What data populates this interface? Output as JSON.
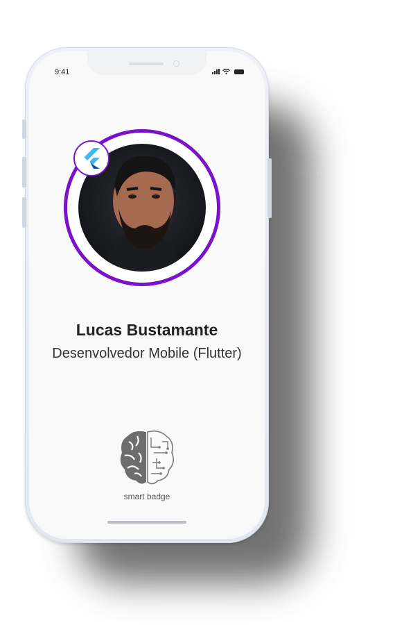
{
  "status_bar": {
    "time": "9:41"
  },
  "profile": {
    "name": "Lucas Bustamante",
    "role": "Desenvolvedor Mobile (Flutter)",
    "ring_color": "#7a12c9",
    "badge_icon": "flutter-logo-icon",
    "photo": "avatar-photo"
  },
  "brand": {
    "label": "smart badge",
    "icon": "brain-circuit-icon"
  }
}
